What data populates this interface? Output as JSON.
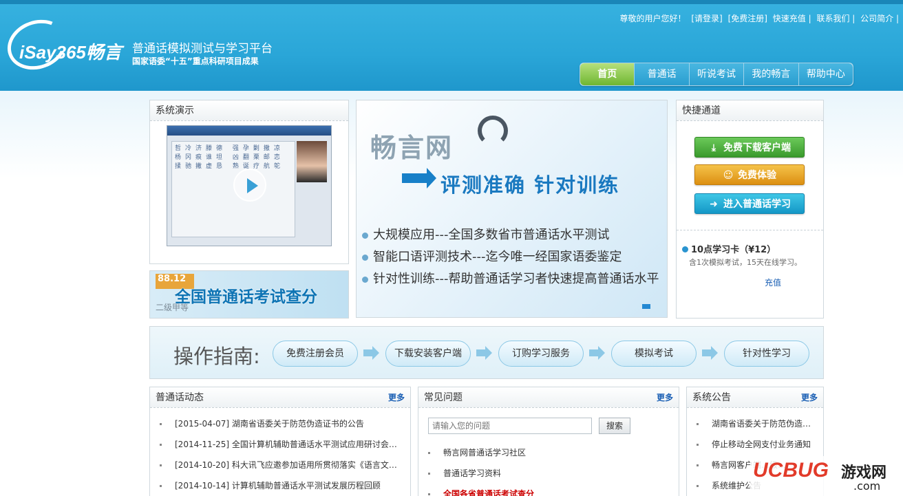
{
  "header": {
    "logo": "iSay365畅言",
    "slogan": "普通话模拟测试与学习平台",
    "sub_slogan": "国家语委“十五”重点科研项目成果",
    "top_links": [
      "尊敬的用户您好！",
      "[请登录]",
      "[免费注册]",
      "快速充值 |",
      "联系我们 |",
      "公司简介 |"
    ]
  },
  "nav": [
    "首页",
    "普通话",
    "听说考试",
    "我的畅言",
    "帮助中心"
  ],
  "demo": {
    "title": "系统演示",
    "grid_text": "哲冷济滕德 强孕剿撒凉 杨冈痕谁坦 凶翻栗邮恋 揉驰撇虚恳 熟诞疗航鸵",
    "banner_score": "88.12",
    "banner_text": "全国普通话考试查分",
    "banner_level": "二级甲等"
  },
  "hero": {
    "brand": "畅言网",
    "headline": "评测准确  针对训练",
    "bullets": [
      "大规模应用---全国多数省市普通话水平测试",
      "智能口语评测技术---迄今唯一经国家语委鉴定",
      "针对性训练---帮助普通话学习者快速提高普通话水平"
    ]
  },
  "quick": {
    "title": "快捷通道",
    "buttons": [
      "免费下载客户端",
      "免费体验",
      "进入普通话学习"
    ],
    "card_title": "10点学习卡（¥12）",
    "card_desc": "含1次模拟考试，15天在线学习。",
    "recharge": "充值"
  },
  "guide": {
    "label": "操作指南:",
    "steps": [
      "免费注册会员",
      "下载安装客户端",
      "订购学习服务",
      "模拟考试",
      "针对性学习"
    ]
  },
  "news": {
    "title": "普通话动态",
    "more": "更多",
    "items": [
      "[2015-04-07] 湖南省语委关于防范伪造证书的公告",
      "[2014-11-25] 全国计算机辅助普通话水平测试应用研讨会成…",
      "[2014-10-20] 科大讯飞应邀参加语用所贯彻落实《语言文字…",
      "[2014-10-14] 计算机辅助普通话水平测试发展历程回顾"
    ]
  },
  "faq": {
    "title": "常见问题",
    "more": "更多",
    "placeholder": "请输入您的问题",
    "search": "搜索",
    "items": [
      "畅言网普通话学习社区",
      "普通话学习资料",
      "全国各省普通话考试查分"
    ]
  },
  "notice": {
    "title": "系统公告",
    "more": "更多",
    "items": [
      "湖南省语委关于防范伪造证…",
      "停止移动全网支付业务通知",
      "畅言网客户端…级…",
      "系统维护公告"
    ]
  },
  "watermark": {
    "brand": "UCBUG",
    "cn": "游戏网",
    "domain": ".com"
  }
}
